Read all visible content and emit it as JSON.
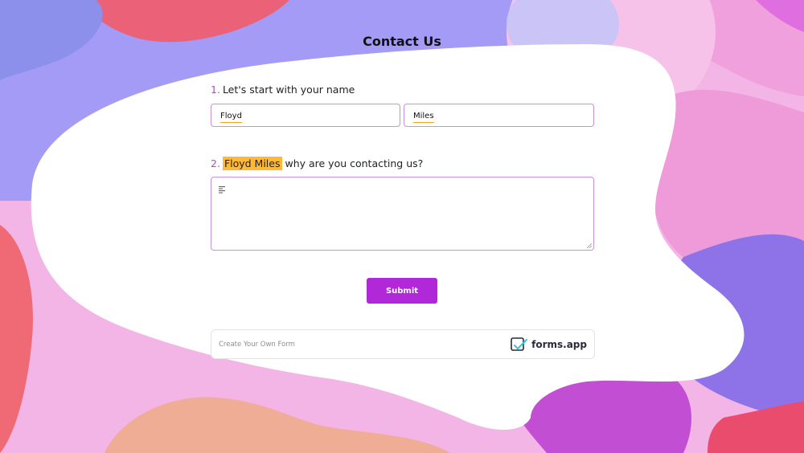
{
  "page": {
    "title": "Contact Us"
  },
  "question1": {
    "number": "1.",
    "label": "Let's start with your name",
    "first_name_value": "Floyd",
    "last_name_value": "Miles"
  },
  "question2": {
    "number": "2.",
    "highlight_name": "Floyd Miles",
    "label_rest": " why are you contacting us?",
    "message_value": ""
  },
  "submit": {
    "label": "Submit"
  },
  "footer": {
    "create_link": "Create Your Own Form",
    "brand_text": "forms.app",
    "brand_icon": "forms-app-logo-icon"
  },
  "colors": {
    "accent": "#b028d8",
    "number_color": "#c23bd9",
    "highlight": "#ffb938",
    "input_border": "#c98ee7",
    "underline": "#f1a31d"
  }
}
